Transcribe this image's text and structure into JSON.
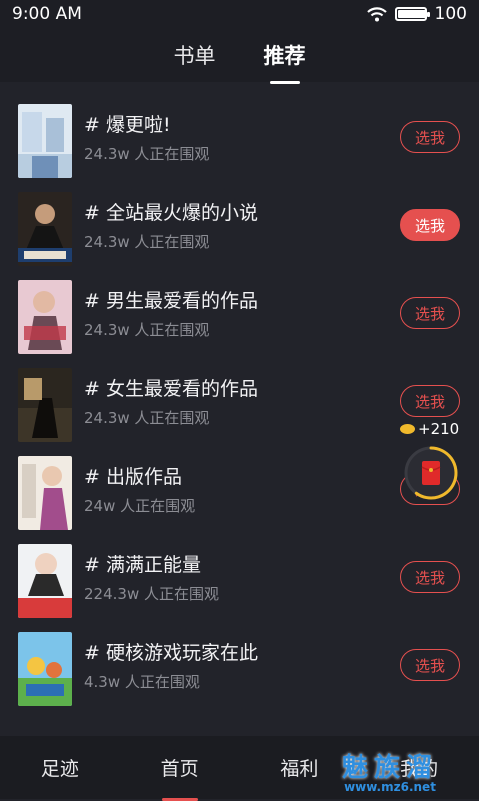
{
  "status_bar": {
    "time": "9:00 AM",
    "battery_text": "100",
    "battery_level": 1.0
  },
  "header": {
    "tabs": [
      {
        "label": "书单"
      },
      {
        "label": "推荐",
        "active": true
      }
    ]
  },
  "list": {
    "items": [
      {
        "title": "# 爆更啦!",
        "subtitle": "24.3w 人正在围观",
        "button": "选我",
        "filled": false
      },
      {
        "title": "# 全站最火爆的小说",
        "subtitle": "24.3w 人正在围观",
        "button": "选我",
        "filled": true
      },
      {
        "title": "# 男生最爱看的作品",
        "subtitle": "24.3w 人正在围观",
        "button": "选我",
        "filled": false
      },
      {
        "title": "# 女生最爱看的作品",
        "subtitle": "24.3w 人正在围观",
        "button": "选我",
        "filled": false
      },
      {
        "title": "# 出版作品",
        "subtitle": "24w 人正在围观",
        "button": "选我",
        "filled": false
      },
      {
        "title": "# 满满正能量",
        "subtitle": "224.3w 人正在围观",
        "button": "选我",
        "filled": false
      },
      {
        "title": "# 硬核游戏玩家在此",
        "subtitle": "4.3w 人正在围观",
        "button": "选我",
        "filled": false
      }
    ]
  },
  "float_widget": {
    "coin_text": "+210",
    "progress": 0.6
  },
  "bottom_nav": {
    "items": [
      {
        "label": "足迹"
      },
      {
        "label": "首页",
        "active": true
      },
      {
        "label": "福利"
      },
      {
        "label": "我的"
      }
    ]
  },
  "watermark": {
    "brand": "魅族溜",
    "url": "www.mz6.net"
  },
  "icons": {
    "wifi": "wifi-icon",
    "battery": "battery-icon",
    "coin": "coin-icon",
    "envelope": "red-envelope-icon"
  },
  "colors": {
    "accent": "#e5504f",
    "background": "#22232a",
    "coin": "#f0b92c"
  }
}
